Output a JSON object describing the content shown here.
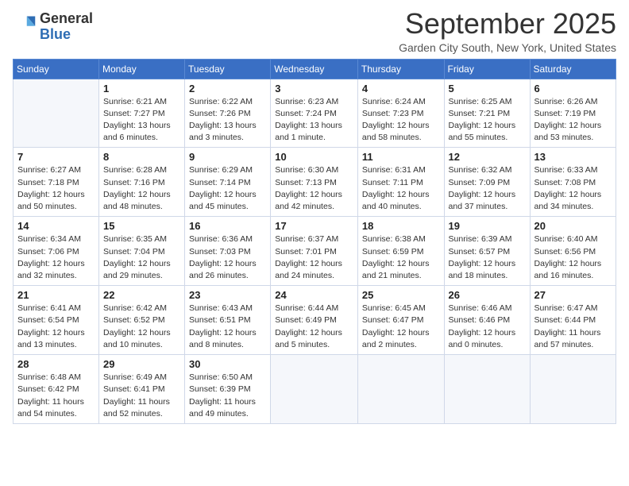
{
  "header": {
    "logo_general": "General",
    "logo_blue": "Blue",
    "month_title": "September 2025",
    "location": "Garden City South, New York, United States"
  },
  "days_of_week": [
    "Sunday",
    "Monday",
    "Tuesday",
    "Wednesday",
    "Thursday",
    "Friday",
    "Saturday"
  ],
  "weeks": [
    [
      {
        "day": null
      },
      {
        "day": 1,
        "sunrise": "6:21 AM",
        "sunset": "7:27 PM",
        "daylight": "13 hours and 6 minutes."
      },
      {
        "day": 2,
        "sunrise": "6:22 AM",
        "sunset": "7:26 PM",
        "daylight": "13 hours and 3 minutes."
      },
      {
        "day": 3,
        "sunrise": "6:23 AM",
        "sunset": "7:24 PM",
        "daylight": "13 hours and 1 minute."
      },
      {
        "day": 4,
        "sunrise": "6:24 AM",
        "sunset": "7:23 PM",
        "daylight": "12 hours and 58 minutes."
      },
      {
        "day": 5,
        "sunrise": "6:25 AM",
        "sunset": "7:21 PM",
        "daylight": "12 hours and 55 minutes."
      },
      {
        "day": 6,
        "sunrise": "6:26 AM",
        "sunset": "7:19 PM",
        "daylight": "12 hours and 53 minutes."
      }
    ],
    [
      {
        "day": 7,
        "sunrise": "6:27 AM",
        "sunset": "7:18 PM",
        "daylight": "12 hours and 50 minutes."
      },
      {
        "day": 8,
        "sunrise": "6:28 AM",
        "sunset": "7:16 PM",
        "daylight": "12 hours and 48 minutes."
      },
      {
        "day": 9,
        "sunrise": "6:29 AM",
        "sunset": "7:14 PM",
        "daylight": "12 hours and 45 minutes."
      },
      {
        "day": 10,
        "sunrise": "6:30 AM",
        "sunset": "7:13 PM",
        "daylight": "12 hours and 42 minutes."
      },
      {
        "day": 11,
        "sunrise": "6:31 AM",
        "sunset": "7:11 PM",
        "daylight": "12 hours and 40 minutes."
      },
      {
        "day": 12,
        "sunrise": "6:32 AM",
        "sunset": "7:09 PM",
        "daylight": "12 hours and 37 minutes."
      },
      {
        "day": 13,
        "sunrise": "6:33 AM",
        "sunset": "7:08 PM",
        "daylight": "12 hours and 34 minutes."
      }
    ],
    [
      {
        "day": 14,
        "sunrise": "6:34 AM",
        "sunset": "7:06 PM",
        "daylight": "12 hours and 32 minutes."
      },
      {
        "day": 15,
        "sunrise": "6:35 AM",
        "sunset": "7:04 PM",
        "daylight": "12 hours and 29 minutes."
      },
      {
        "day": 16,
        "sunrise": "6:36 AM",
        "sunset": "7:03 PM",
        "daylight": "12 hours and 26 minutes."
      },
      {
        "day": 17,
        "sunrise": "6:37 AM",
        "sunset": "7:01 PM",
        "daylight": "12 hours and 24 minutes."
      },
      {
        "day": 18,
        "sunrise": "6:38 AM",
        "sunset": "6:59 PM",
        "daylight": "12 hours and 21 minutes."
      },
      {
        "day": 19,
        "sunrise": "6:39 AM",
        "sunset": "6:57 PM",
        "daylight": "12 hours and 18 minutes."
      },
      {
        "day": 20,
        "sunrise": "6:40 AM",
        "sunset": "6:56 PM",
        "daylight": "12 hours and 16 minutes."
      }
    ],
    [
      {
        "day": 21,
        "sunrise": "6:41 AM",
        "sunset": "6:54 PM",
        "daylight": "12 hours and 13 minutes."
      },
      {
        "day": 22,
        "sunrise": "6:42 AM",
        "sunset": "6:52 PM",
        "daylight": "12 hours and 10 minutes."
      },
      {
        "day": 23,
        "sunrise": "6:43 AM",
        "sunset": "6:51 PM",
        "daylight": "12 hours and 8 minutes."
      },
      {
        "day": 24,
        "sunrise": "6:44 AM",
        "sunset": "6:49 PM",
        "daylight": "12 hours and 5 minutes."
      },
      {
        "day": 25,
        "sunrise": "6:45 AM",
        "sunset": "6:47 PM",
        "daylight": "12 hours and 2 minutes."
      },
      {
        "day": 26,
        "sunrise": "6:46 AM",
        "sunset": "6:46 PM",
        "daylight": "12 hours and 0 minutes."
      },
      {
        "day": 27,
        "sunrise": "6:47 AM",
        "sunset": "6:44 PM",
        "daylight": "11 hours and 57 minutes."
      }
    ],
    [
      {
        "day": 28,
        "sunrise": "6:48 AM",
        "sunset": "6:42 PM",
        "daylight": "11 hours and 54 minutes."
      },
      {
        "day": 29,
        "sunrise": "6:49 AM",
        "sunset": "6:41 PM",
        "daylight": "11 hours and 52 minutes."
      },
      {
        "day": 30,
        "sunrise": "6:50 AM",
        "sunset": "6:39 PM",
        "daylight": "11 hours and 49 minutes."
      },
      {
        "day": null
      },
      {
        "day": null
      },
      {
        "day": null
      },
      {
        "day": null
      }
    ]
  ],
  "labels": {
    "sunrise": "Sunrise:",
    "sunset": "Sunset:",
    "daylight": "Daylight:"
  }
}
